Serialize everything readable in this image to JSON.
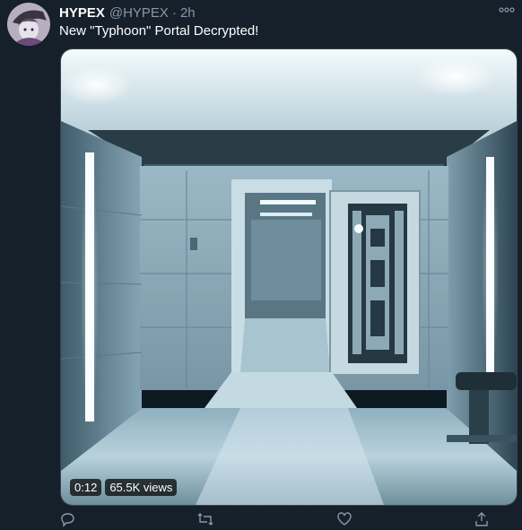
{
  "tweet": {
    "author_name": "HYPEX",
    "handle": "@HYPEX",
    "separator": "·",
    "time": "2h",
    "text": "New \"Typhoon\" Portal Decrypted!"
  },
  "media": {
    "type": "video",
    "duration": "0:12",
    "views": "65.5K views"
  },
  "icons": {
    "more": "more-horizontal-icon",
    "reply": "reply-icon",
    "retweet": "retweet-icon",
    "like": "like-icon",
    "share": "share-icon"
  },
  "colors": {
    "background": "#15202b",
    "secondary_text": "#8899a6",
    "border": "#38444d"
  }
}
